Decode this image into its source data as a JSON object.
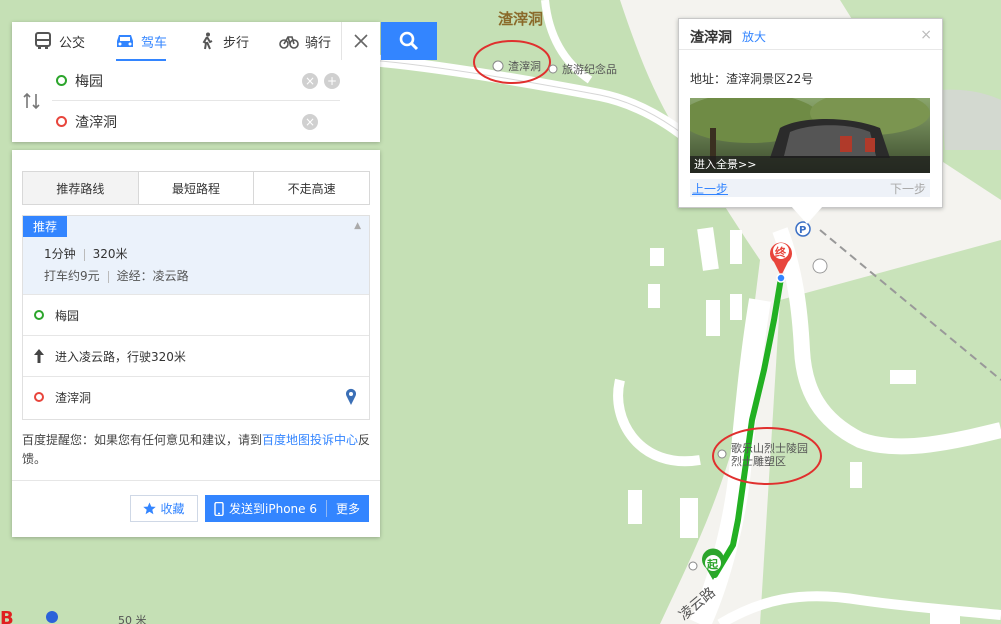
{
  "nav": {
    "tabs": [
      {
        "label": "公交",
        "icon": "bus-icon"
      },
      {
        "label": "驾车",
        "icon": "car-icon"
      },
      {
        "label": "步行",
        "icon": "walk-icon"
      },
      {
        "label": "骑行",
        "icon": "bike-icon"
      }
    ],
    "active_tab": "驾车"
  },
  "route_inputs": {
    "start": "梅园",
    "end": "渣滓洞"
  },
  "route_options": {
    "tabs": [
      "推荐路线",
      "最短路程",
      "不走高速"
    ],
    "active": "推荐路线"
  },
  "recommended": {
    "badge": "推荐",
    "duration": "1分钟",
    "distance": "320米",
    "taxi": "打车约9元",
    "via": "途经：凌云路"
  },
  "steps": [
    {
      "label": "梅园",
      "type": "start"
    },
    {
      "label": "进入凌云路，行驶320米",
      "type": "straight"
    },
    {
      "label": "渣滓洞",
      "type": "end"
    }
  ],
  "tip": {
    "prefix": "百度提醒您：如果您有任何意见和建议，请到",
    "link": "百度地图投诉中心",
    "suffix": "反馈。"
  },
  "actions": {
    "favorite": "收藏",
    "send": "发送到iPhone 6",
    "more": "更多"
  },
  "popup": {
    "title": "渣滓洞",
    "zoom": "放大",
    "address": "地址：渣滓洞景区22号",
    "photo_caption": "进入全景>>",
    "prev": "上一步",
    "next": "下一步"
  },
  "map": {
    "area_label": "渣滓洞",
    "poi_zhazidong": "渣滓洞",
    "poi_memorial": "旅游纪念品",
    "poi_cemetery_l1": "歌乐山烈士陵园",
    "poi_cemetery_l2": "烈士雕塑区",
    "road": "凌云路",
    "start_marker": "起",
    "end_marker": "终",
    "parking": "P",
    "scale": "50 米",
    "colors": {
      "route": "#22b022",
      "start": "#2ca52c",
      "end": "#e8453c",
      "water": "#c7e2bf",
      "road": "#ffffff",
      "annotation": "#e0302e"
    }
  }
}
